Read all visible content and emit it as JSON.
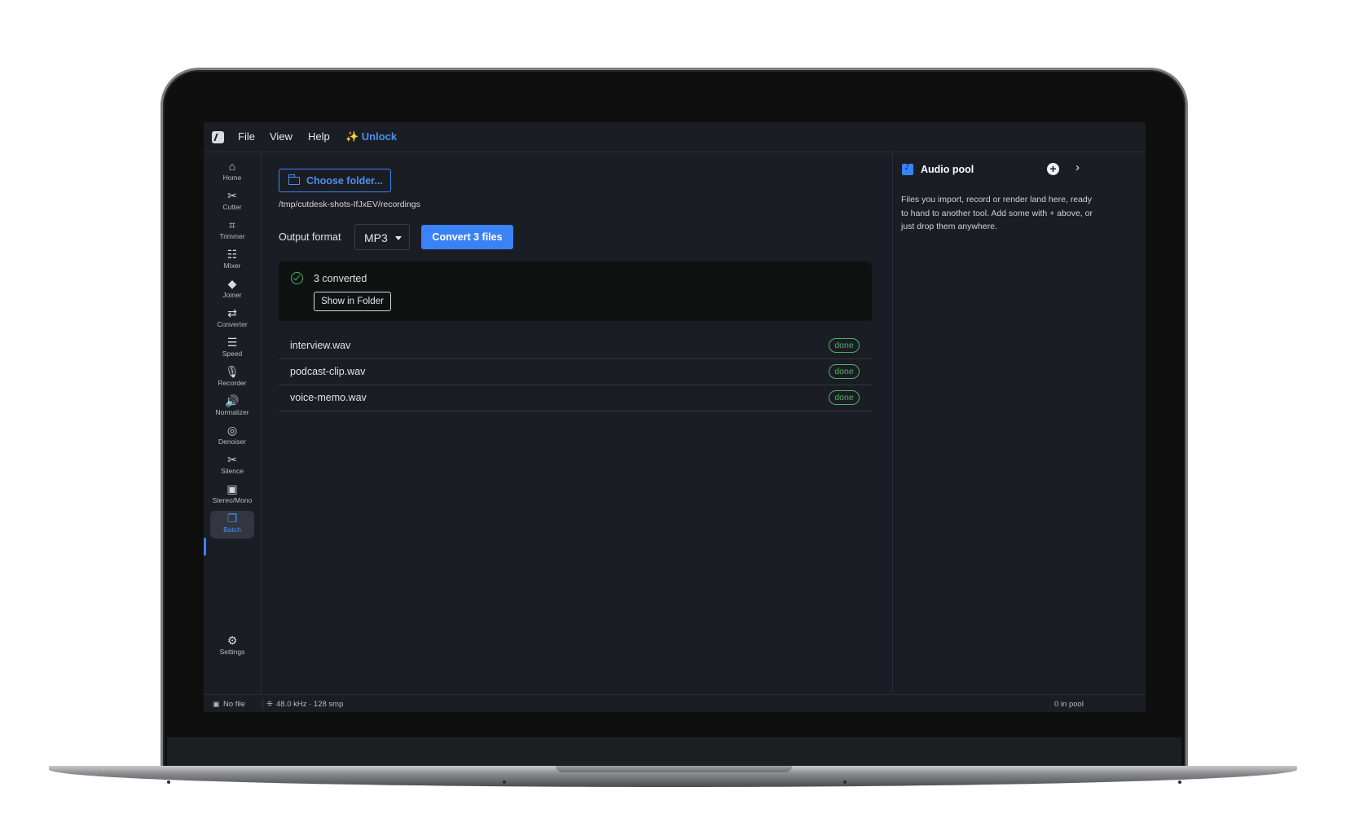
{
  "menu": {
    "file": "File",
    "view": "View",
    "help": "Help",
    "unlock": "✨ Unlock"
  },
  "sidebar": {
    "items": [
      {
        "label": "Home",
        "icon": "home-icon",
        "glyph": "⌂"
      },
      {
        "label": "Cutter",
        "icon": "scissors-icon",
        "glyph": "✂"
      },
      {
        "label": "Trimmer",
        "icon": "crop-icon",
        "glyph": "⌗"
      },
      {
        "label": "Mixer",
        "icon": "mixer-icon",
        "glyph": "☷"
      },
      {
        "label": "Joiner",
        "icon": "layers-icon",
        "glyph": "◆"
      },
      {
        "label": "Converter",
        "icon": "swap-icon",
        "glyph": "⇄"
      },
      {
        "label": "Speed",
        "icon": "sliders-icon",
        "glyph": "☰"
      },
      {
        "label": "Recorder",
        "icon": "mic-icon",
        "glyph": "🎙"
      },
      {
        "label": "Normalizer",
        "icon": "volume-icon",
        "glyph": "🔊"
      },
      {
        "label": "Denoiser",
        "icon": "denoise-icon",
        "glyph": "◎"
      },
      {
        "label": "Silence",
        "icon": "scissors-icon",
        "glyph": "✂"
      },
      {
        "label": "Stereo/Mono",
        "icon": "speaker-icon",
        "glyph": "▣"
      },
      {
        "label": "Batch",
        "icon": "batch-icon",
        "glyph": "❐"
      }
    ],
    "settings": {
      "label": "Settings",
      "icon": "gear-icon",
      "glyph": "⚙"
    }
  },
  "main": {
    "choose_folder": "Choose folder...",
    "path": "/tmp/cutdesk-shots-IfJxEV/recordings",
    "output_format_label": "Output format",
    "output_format_value": "MP3",
    "convert_button": "Convert 3 files",
    "result_message": "3 converted",
    "show_in_folder": "Show in Folder",
    "files": [
      {
        "name": "interview.wav",
        "status": "done"
      },
      {
        "name": "podcast-clip.wav",
        "status": "done"
      },
      {
        "name": "voice-memo.wav",
        "status": "done"
      }
    ]
  },
  "pool": {
    "title": "Audio pool",
    "add": "+",
    "collapse": "›",
    "empty_text": "Files you import, record or render land here, ready to hand to another tool. Add some with + above, or just drop them anywhere."
  },
  "status": {
    "file": "No file",
    "audio": "48.0 kHz · 128 smp",
    "pool_count": "0 in pool"
  },
  "colors": {
    "accent": "#3b82f6",
    "success": "#4cb26a",
    "background": "#1b1d24"
  }
}
